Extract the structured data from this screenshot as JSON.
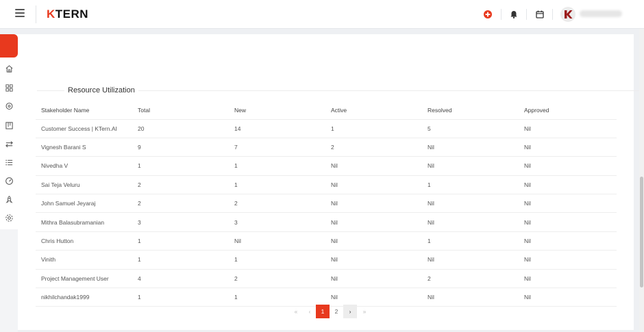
{
  "header": {
    "logo_mark": "K",
    "logo_text": "TERN"
  },
  "colors": {
    "accent": "#e8391e",
    "sidebar_active": "#e8391e"
  },
  "header_icons": [
    "add-circle-icon",
    "bell-icon",
    "calendar-icon"
  ],
  "sidebar": {
    "icons": [
      "home-icon",
      "grid-icon",
      "location-pin-icon",
      "board-icon",
      "transfer-icon",
      "list-icon",
      "dashboard-gauge-icon",
      "rocket-icon",
      "settings-icon"
    ]
  },
  "section": {
    "title": "Resource Utilization"
  },
  "table": {
    "columns": [
      "Stakeholder Name",
      "Total",
      "New",
      "Active",
      "Resolved",
      "Approved"
    ],
    "rows": [
      [
        "Customer Success | KTern.AI",
        "20",
        "14",
        "1",
        "5",
        "Nil"
      ],
      [
        "Vignesh Barani S",
        "9",
        "7",
        "2",
        "Nil",
        "Nil"
      ],
      [
        "Nivedha V",
        "1",
        "1",
        "Nil",
        "Nil",
        "Nil"
      ],
      [
        "Sai Teja Veluru",
        "2",
        "1",
        "Nil",
        "1",
        "Nil"
      ],
      [
        "John Samuel Jeyaraj",
        "2",
        "2",
        "Nil",
        "Nil",
        "Nil"
      ],
      [
        "Mithra Balasubramanian",
        "3",
        "3",
        "Nil",
        "Nil",
        "Nil"
      ],
      [
        "Chris Hutton",
        "1",
        "Nil",
        "Nil",
        "1",
        "Nil"
      ],
      [
        "Vinith",
        "1",
        "1",
        "Nil",
        "Nil",
        "Nil"
      ],
      [
        "Project Management User",
        "4",
        "2",
        "Nil",
        "2",
        "Nil"
      ],
      [
        "nikhilchandak1999",
        "1",
        "1",
        "Nil",
        "Nil",
        "Nil"
      ]
    ]
  },
  "pagination": {
    "first": "«",
    "prev": "‹",
    "pages": [
      "1",
      "2"
    ],
    "current_page": "1",
    "next": "›",
    "last": "»"
  }
}
